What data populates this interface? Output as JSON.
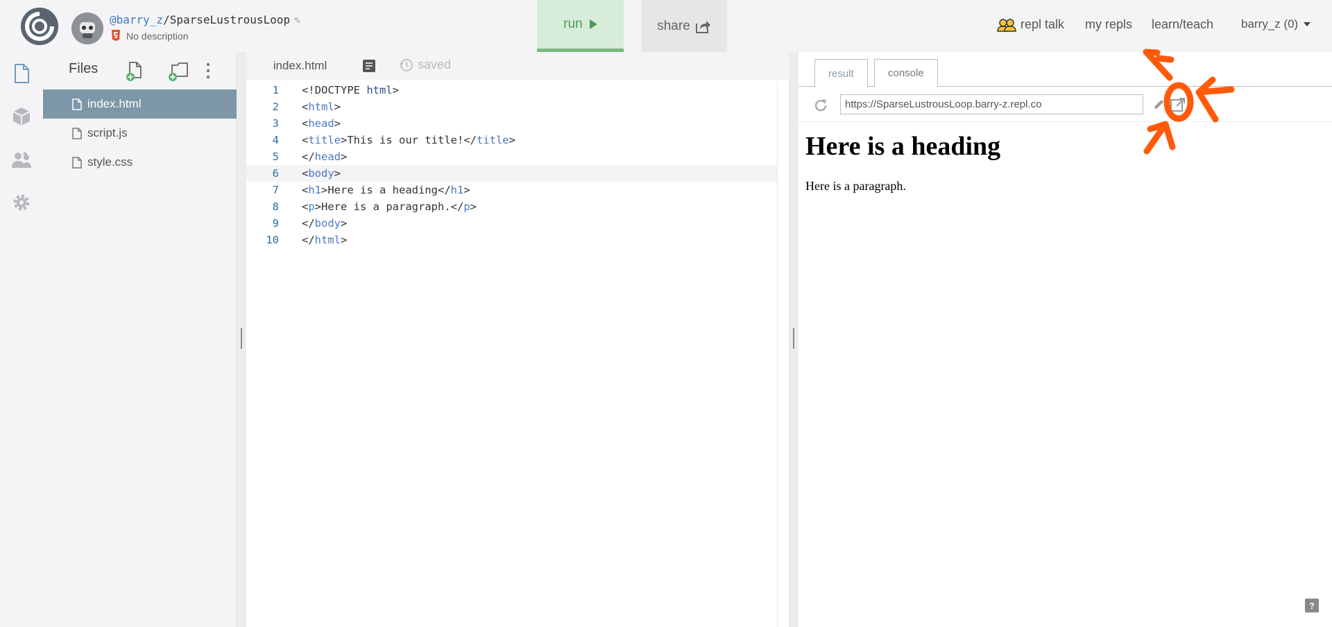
{
  "header": {
    "username_link": "@barry_z",
    "separator": "/",
    "repl_name": "SparseLustrousLoop",
    "description": "No description",
    "run_label": "run",
    "share_label": "share",
    "nav": {
      "repl_talk": "repl talk",
      "my_repls": "my repls",
      "learn_teach": "learn/teach",
      "user_menu": "barry_z (0)"
    }
  },
  "rail": {
    "icons": [
      "file-icon",
      "package-icon",
      "multiplayer-icon",
      "settings-icon"
    ]
  },
  "files": {
    "title": "Files",
    "items": [
      {
        "name": "index.html",
        "active": true
      },
      {
        "name": "script.js",
        "active": false
      },
      {
        "name": "style.css",
        "active": false
      }
    ]
  },
  "editor": {
    "tab_label": "index.html",
    "status": "saved",
    "current_line": 6,
    "lines": [
      "<!DOCTYPE html>",
      "<html>",
      "<head>",
      "<title>This is our title!</title>",
      "</head>",
      "<body>",
      "<h1>Here is a heading</h1>",
      "<p>Here is a paragraph.</p>",
      "</body>",
      "</html>"
    ]
  },
  "output": {
    "tabs": [
      "result",
      "console"
    ],
    "active_tab": "result",
    "url": "https://SparseLustrousLoop.barry-z.repl.co",
    "preview_heading": "Here is a heading",
    "preview_paragraph": "Here is a paragraph.",
    "help_label": "?"
  },
  "colors": {
    "run_bg": "#d7ecd9",
    "run_text": "#4f9a57",
    "active_file_bg": "#7d97a8",
    "annotation": "#ff5a0a"
  }
}
